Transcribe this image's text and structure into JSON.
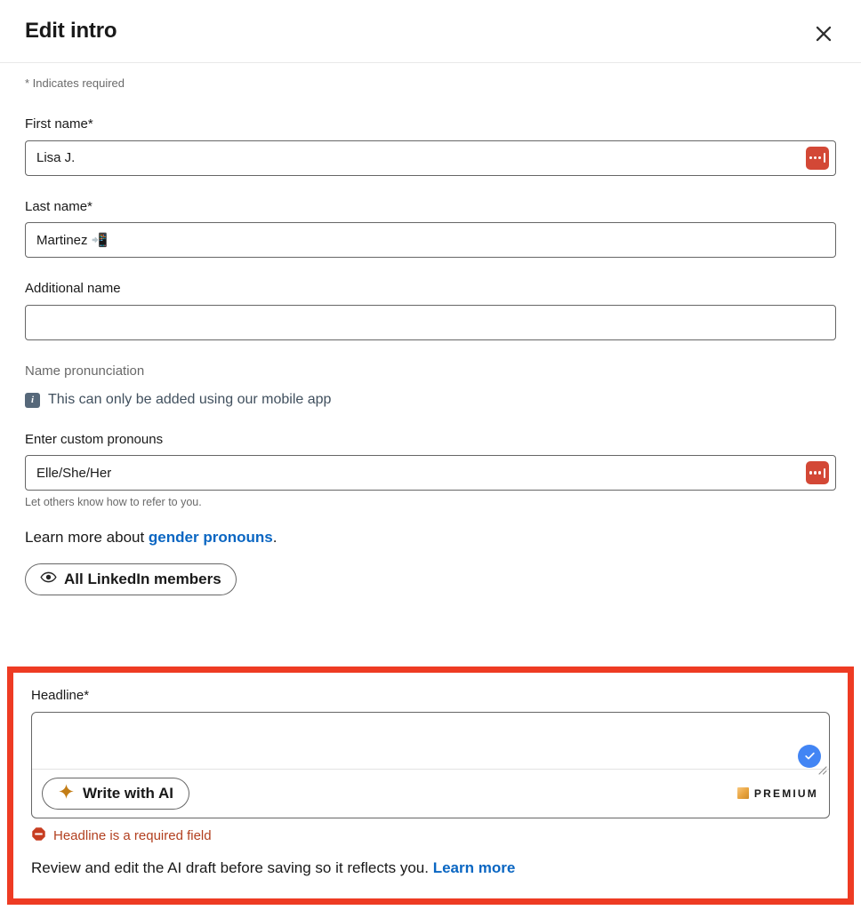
{
  "header": {
    "title": "Edit intro",
    "close_label": "Dismiss"
  },
  "body": {
    "required_note": "* Indicates required"
  },
  "fields": {
    "first_name": {
      "label": "First name*",
      "value": "Lisa J.",
      "placeholder": "",
      "autofill_icon": "lastpass-icon"
    },
    "last_name": {
      "label": "Last name*",
      "value": "Martinez 📲",
      "placeholder": ""
    },
    "additional_name": {
      "label": "Additional name",
      "value": "",
      "placeholder": ""
    },
    "name_pronunciation": {
      "label": "Name pronunciation",
      "note": "This can only be added using our mobile app",
      "info_icon": "info-icon"
    },
    "pronouns": {
      "label": "Enter custom pronouns",
      "value": "Elle/She/Her",
      "placeholder": "",
      "helper": "Let others know how to refer to you.",
      "autofill_icon": "lastpass-icon"
    }
  },
  "learn_more_line": {
    "prefix": "Learn more about ",
    "link": "gender pronouns",
    "suffix": "."
  },
  "visibility": {
    "label": "All LinkedIn members",
    "icon": "eye-icon"
  },
  "headline": {
    "label": "Headline*",
    "value": "",
    "placeholder": "",
    "grammar_badge_icon": "check-circle-icon",
    "resize_handle": "resize-grip-icon",
    "ai_button_label": "Write with AI",
    "ai_button_icon": "sparkle-icon",
    "premium_label": "PREMIUM",
    "premium_icon": "linkedin-premium-icon",
    "error_text": "Headline is a required field",
    "error_icon": "error-octagon-icon",
    "note_prefix": "Review and edit the AI draft before saving so it reflects you. ",
    "note_link": "Learn more"
  },
  "colors": {
    "highlight_border": "#ee3b23",
    "link_blue": "#0a66c2",
    "error_red": "#b24020",
    "lastpass_red": "#d34836",
    "premium_gold": "#e7a33e",
    "grammar_blue": "#4285f4",
    "info_slate": "#56687a"
  }
}
